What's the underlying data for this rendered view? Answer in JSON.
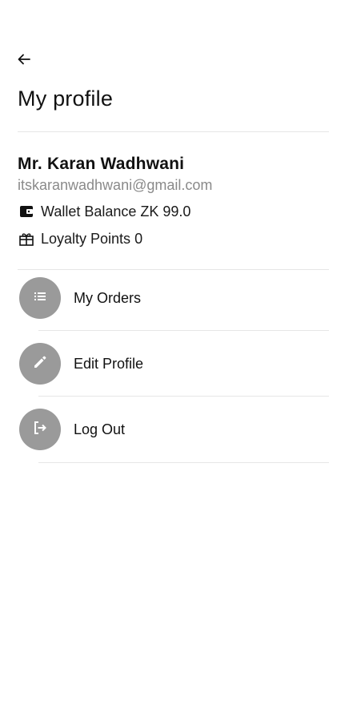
{
  "header": {
    "title": "My profile",
    "back_icon": "arrow-left-icon"
  },
  "profile": {
    "name": "Mr. Karan Wadhwani",
    "email": "itskaranwadhwani@gmail.com",
    "wallet": {
      "icon": "wallet-icon",
      "label": "Wallet Balance",
      "value": "ZK 99.0"
    },
    "loyalty": {
      "icon": "loyalty-gift-icon",
      "label": "Loyalty Points",
      "value": "0"
    }
  },
  "menu": [
    {
      "label": "My Orders",
      "icon": "list-icon"
    },
    {
      "label": "Edit Profile",
      "icon": "pencil-icon"
    },
    {
      "label": "Log Out",
      "icon": "logout-icon"
    }
  ],
  "colors": {
    "icon_circle": "#9a9a9a",
    "divider": "#e6e6e6",
    "email_text": "#8a8a8a"
  }
}
